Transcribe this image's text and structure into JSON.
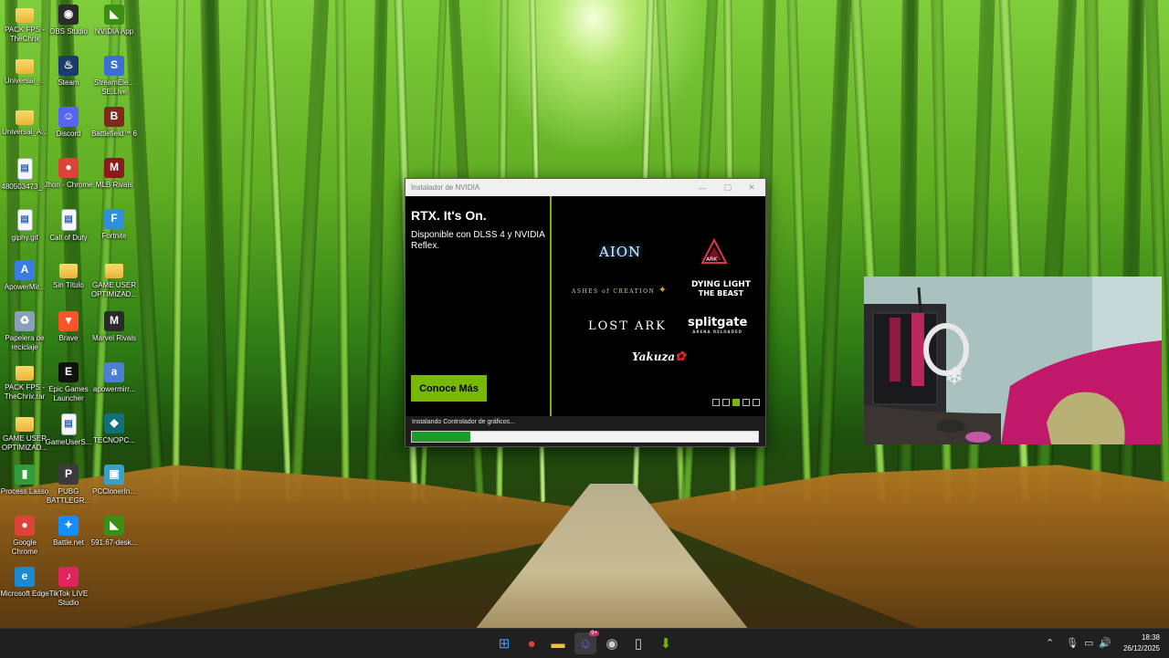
{
  "desktop": {
    "icons": [
      {
        "label": "PACK FPS - TheChrix",
        "icon": "folder-icon",
        "kind": "folder"
      },
      {
        "label": "OBS Studio",
        "icon": "obs-icon",
        "kind": "app",
        "color": "#2a2a2a",
        "glyph": "◉"
      },
      {
        "label": "NVIDIA App",
        "icon": "nvidia-icon",
        "kind": "app",
        "color": "#3a8f12",
        "glyph": "◣"
      },
      {
        "label": "Universal_...",
        "icon": "folder-icon",
        "kind": "folder"
      },
      {
        "label": "Steam",
        "icon": "steam-icon",
        "kind": "app",
        "color": "#1b3b6a",
        "glyph": "♨"
      },
      {
        "label": "StreamEle... SE.Live",
        "icon": "streamelements-icon",
        "kind": "app",
        "color": "#3b6fd1",
        "glyph": "S"
      },
      {
        "label": "Universal_A...",
        "icon": "folder-icon",
        "kind": "folder"
      },
      {
        "label": "Discord",
        "icon": "discord-icon",
        "kind": "app",
        "color": "#5865f2",
        "glyph": "☺"
      },
      {
        "label": "Battlefield™ 6",
        "icon": "battlefield-icon",
        "kind": "app",
        "color": "#7a2b1c",
        "glyph": "B"
      },
      {
        "label": "480503473_...",
        "icon": "image-file-icon",
        "kind": "file"
      },
      {
        "label": "Jhon - Chrome",
        "icon": "chrome-icon",
        "kind": "app",
        "color": "#db4437",
        "glyph": "●"
      },
      {
        "label": "MLB Rivals",
        "icon": "mlb-icon",
        "kind": "app",
        "color": "#8b1a1a",
        "glyph": "M"
      },
      {
        "label": "giphy.gif",
        "icon": "gif-file-icon",
        "kind": "file"
      },
      {
        "label": "Call of Duty",
        "icon": "file-icon",
        "kind": "file"
      },
      {
        "label": "Fortnite",
        "icon": "fortnite-icon",
        "kind": "app",
        "color": "#2f8fd8",
        "glyph": "F"
      },
      {
        "label": "ApowerMir...",
        "icon": "apowermirror-icon",
        "kind": "app",
        "color": "#3a7de0",
        "glyph": "A"
      },
      {
        "label": "Sin Título",
        "icon": "folder-icon",
        "kind": "folder"
      },
      {
        "label": "GAME USER OPTIMIZAD...",
        "icon": "folder-icon",
        "kind": "folder"
      },
      {
        "label": "Papelera de reciclaje",
        "icon": "recycle-bin-icon",
        "kind": "app",
        "color": "#8aa0b8",
        "glyph": "♻"
      },
      {
        "label": "Brave",
        "icon": "brave-icon",
        "kind": "app",
        "color": "#fb542b",
        "glyph": "▼"
      },
      {
        "label": "Marvel Rivals",
        "icon": "marvel-rivals-icon",
        "kind": "app",
        "color": "#2a2a2a",
        "glyph": "M"
      },
      {
        "label": "PACK FPS - TheChrix.rar",
        "icon": "folder-icon",
        "kind": "folder"
      },
      {
        "label": "Epic Games Launcher",
        "icon": "epic-games-icon",
        "kind": "app",
        "color": "#111111",
        "glyph": "E"
      },
      {
        "label": "apowermirr...",
        "icon": "apowermirror-icon",
        "kind": "app",
        "color": "#4b7fd6",
        "glyph": "a"
      },
      {
        "label": "GAME USER OPTIMIZAD...",
        "icon": "folder-icon",
        "kind": "folder"
      },
      {
        "label": "GameUserS...",
        "icon": "file-icon",
        "kind": "file"
      },
      {
        "label": "TECNOPC...",
        "icon": "tecnopc-icon",
        "kind": "app",
        "color": "#0f6f7a",
        "glyph": "◆"
      },
      {
        "label": "Process Lasso",
        "icon": "process-lasso-icon",
        "kind": "app",
        "color": "#2f9e3a",
        "glyph": "▮"
      },
      {
        "label": "PUBG BATTLEGR...",
        "icon": "pubg-icon",
        "kind": "app",
        "color": "#3b3b3b",
        "glyph": "P"
      },
      {
        "label": "PCClonerIn...",
        "icon": "pccloner-icon",
        "kind": "app",
        "color": "#3aa0c8",
        "glyph": "▣"
      },
      {
        "label": "Google Chrome",
        "icon": "chrome-icon",
        "kind": "app",
        "color": "#db4437",
        "glyph": "●"
      },
      {
        "label": "Battle.net",
        "icon": "battlenet-icon",
        "kind": "app",
        "color": "#148eff",
        "glyph": "✦"
      },
      {
        "label": "591.67-desk...",
        "icon": "nvidia-driver-icon",
        "kind": "app",
        "color": "#3a8f12",
        "glyph": "◣"
      },
      {
        "label": "Microsoft Edge",
        "icon": "edge-icon",
        "kind": "app",
        "color": "#1b8ad3",
        "glyph": "e"
      },
      {
        "label": "TikTok LIVE Studio",
        "icon": "tiktok-icon",
        "kind": "app",
        "color": "#e0245e",
        "glyph": "♪"
      }
    ]
  },
  "installer": {
    "title": "Instalador de NVIDIA",
    "headline": "RTX. It's On.",
    "subtitle": "Disponible con DLSS 4 y NVIDIA Reflex.",
    "cta_label": "Conoce Más",
    "logos": {
      "aion": "AION",
      "ark": "ARK",
      "ashes": "ASHES of CREATION",
      "dying_light_1": "DYING LIGHT",
      "dying_light_2": "THE BEAST",
      "lost_ark": "LOST ARK",
      "splitgate": "splitgate",
      "splitgate_sub": "ARENA RELOADED",
      "yakuza": "Yakuza"
    },
    "carousel_dots": 5,
    "carousel_active": 2,
    "status_text": "Instalando Controlador de gráficos...",
    "progress": 0.17,
    "accent": "#76b900"
  },
  "taskbar": {
    "apps": [
      {
        "name": "windows-start-icon",
        "color": "#3aa0ff",
        "glyph": "⊞"
      },
      {
        "name": "chrome-icon",
        "color": "#db4437",
        "glyph": "●"
      },
      {
        "name": "file-explorer-icon",
        "color": "#f0c040",
        "glyph": "▬"
      },
      {
        "name": "discord-icon",
        "color": "#5865f2",
        "glyph": "☺",
        "badge": "9+"
      },
      {
        "name": "obs-icon",
        "color": "#cfcfcf",
        "glyph": "◉"
      },
      {
        "name": "installer-icon",
        "color": "#cfd6e0",
        "glyph": "▯"
      },
      {
        "name": "nvidia-installer-icon",
        "color": "#76b900",
        "glyph": "⬇"
      }
    ],
    "time": "18:38",
    "date": "26/12/2025"
  }
}
